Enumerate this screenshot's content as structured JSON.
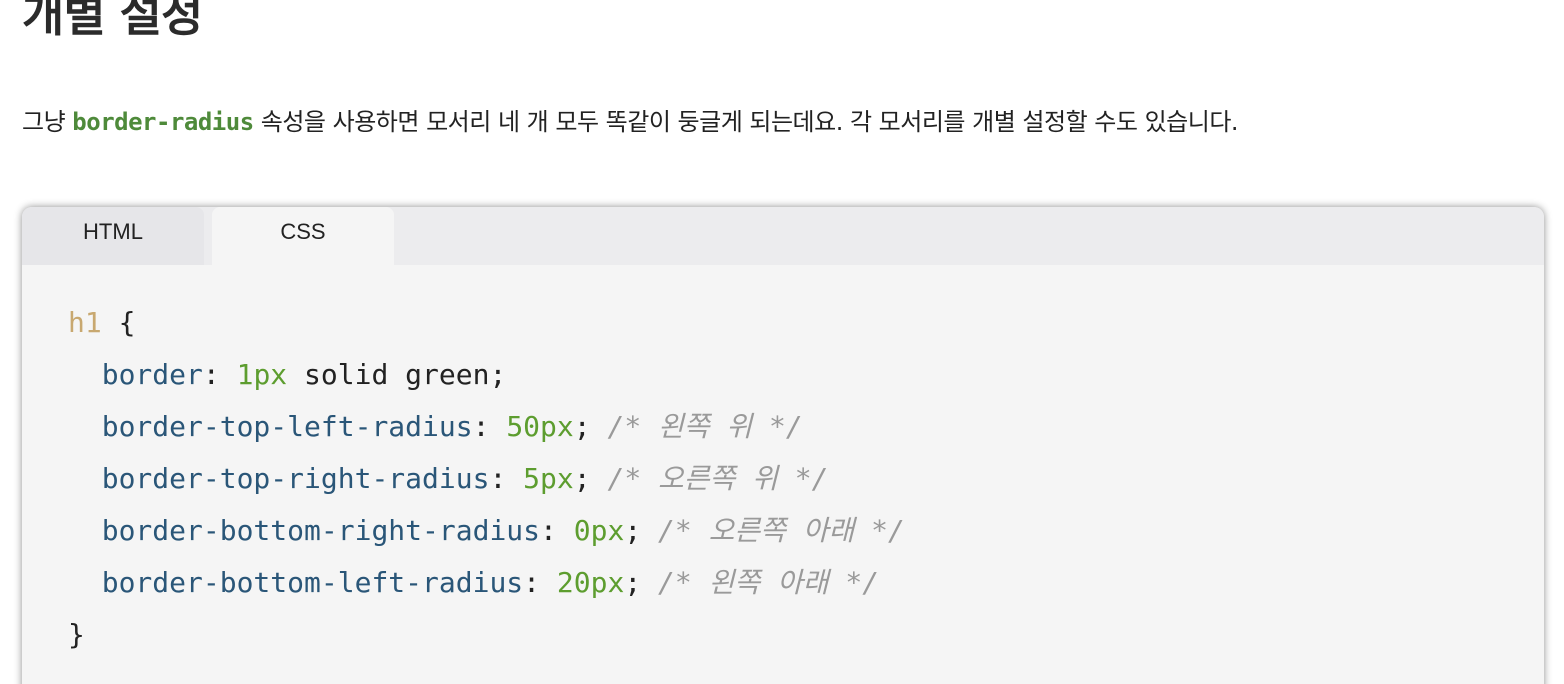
{
  "page": {
    "title": "개별 설정",
    "intro_before": "그냥 ",
    "intro_code": "border-radius",
    "intro_after": " 속성을 사용하면 모서리 네 개 모두 똑같이 둥글게 되는데요. 각 모서리를 개별 설정할 수도 있습니다."
  },
  "tabs": [
    {
      "label": "HTML",
      "active": false
    },
    {
      "label": "CSS",
      "active": true
    }
  ],
  "code": {
    "selector": "h1",
    "open_brace": " {",
    "close_brace": "}",
    "lines": [
      {
        "prop": "border",
        "value": "1px",
        "rest": " solid green;",
        "comment": ""
      },
      {
        "prop": "border-top-left-radius",
        "value": "50px",
        "rest": ";",
        "comment": " /* 왼쪽 위 */"
      },
      {
        "prop": "border-top-right-radius",
        "value": "5px",
        "rest": ";",
        "comment": " /* 오른쪽 위 */"
      },
      {
        "prop": "border-bottom-right-radius",
        "value": "0px",
        "rest": ";",
        "comment": " /* 오른쪽 아래 */"
      },
      {
        "prop": "border-bottom-left-radius",
        "value": "20px",
        "rest": ";",
        "comment": " /* 왼쪽 아래 */"
      }
    ]
  },
  "colors": {
    "selector": "#c8a870",
    "property": "#2a5678",
    "number": "#5d9d2f",
    "comment": "#9a9a9a",
    "inline_code": "#4e8a3a"
  }
}
